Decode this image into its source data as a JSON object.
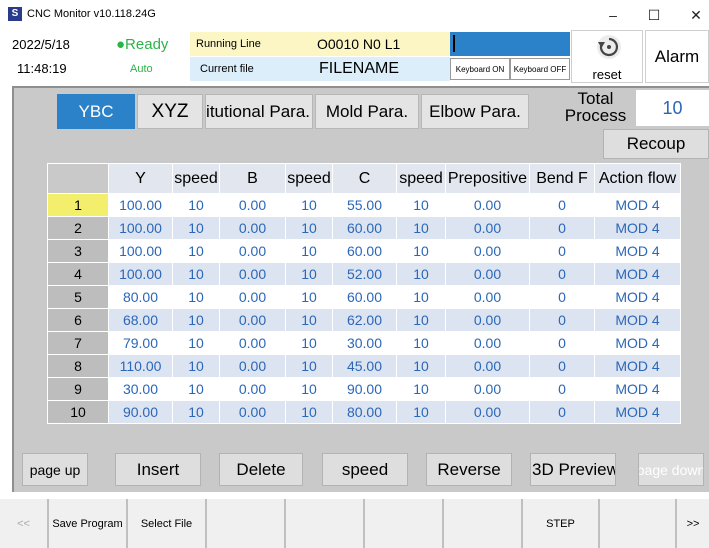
{
  "window": {
    "title": "CNC Monitor v10.118.24G",
    "minimize": "–",
    "maximize": "☐",
    "close": "✕"
  },
  "status": {
    "date": "2022/5/18",
    "time": "11:48:19",
    "state": "●Ready",
    "mode": "Auto",
    "running_line_label": "Running Line",
    "running_line_value": "O0010 N0 L1",
    "current_file_label": "Current file",
    "current_file_value": "FILENAME",
    "keyboard_on": "Keyboard ON",
    "keyboard_off": "Keyboard OFF",
    "reset_label": "reset",
    "alarm_label": "Alarm"
  },
  "tabs": [
    {
      "label": "YBC"
    },
    {
      "label": "XYZ"
    },
    {
      "label": "Institutional Para."
    },
    {
      "label": "Mold Para."
    },
    {
      "label": "Elbow Para."
    }
  ],
  "total_process": {
    "label": "Total Process",
    "value": "10"
  },
  "recoup_label": "Recoup",
  "table": {
    "columns": [
      "Y",
      "speed",
      "B",
      "speed",
      "C",
      "speed",
      "Prepositive",
      "Bend F",
      "Action flow"
    ],
    "rows": [
      [
        "1",
        "100.00",
        "10",
        "0.00",
        "10",
        "55.00",
        "10",
        "0.00",
        "0",
        "MOD 4"
      ],
      [
        "2",
        "100.00",
        "10",
        "0.00",
        "10",
        "60.00",
        "10",
        "0.00",
        "0",
        "MOD 4"
      ],
      [
        "3",
        "100.00",
        "10",
        "0.00",
        "10",
        "60.00",
        "10",
        "0.00",
        "0",
        "MOD 4"
      ],
      [
        "4",
        "100.00",
        "10",
        "0.00",
        "10",
        "52.00",
        "10",
        "0.00",
        "0",
        "MOD 4"
      ],
      [
        "5",
        "80.00",
        "10",
        "0.00",
        "10",
        "60.00",
        "10",
        "0.00",
        "0",
        "MOD 4"
      ],
      [
        "6",
        "68.00",
        "10",
        "0.00",
        "10",
        "62.00",
        "10",
        "0.00",
        "0",
        "MOD 4"
      ],
      [
        "7",
        "79.00",
        "10",
        "0.00",
        "10",
        "30.00",
        "10",
        "0.00",
        "0",
        "MOD 4"
      ],
      [
        "8",
        "110.00",
        "10",
        "0.00",
        "10",
        "45.00",
        "10",
        "0.00",
        "0",
        "MOD 4"
      ],
      [
        "9",
        "30.00",
        "10",
        "0.00",
        "10",
        "90.00",
        "10",
        "0.00",
        "0",
        "MOD 4"
      ],
      [
        "10",
        "90.00",
        "10",
        "0.00",
        "10",
        "80.00",
        "10",
        "0.00",
        "0",
        "MOD 4"
      ]
    ]
  },
  "actions": {
    "page_up": "page up",
    "insert": "Insert",
    "delete": "Delete",
    "speed": "speed",
    "reverse": "Reverse",
    "preview": "3D Preview",
    "page_down": "page down"
  },
  "softkeys": {
    "prev": "<<",
    "save_program": "Save Program",
    "select_file": "Select File",
    "step": "STEP",
    "next": ">>"
  },
  "colors": {
    "accent": "#2b82c8",
    "value_text": "#2a67b8",
    "selected_row": "#f3ef6d",
    "ready_green": "#2db34a"
  }
}
